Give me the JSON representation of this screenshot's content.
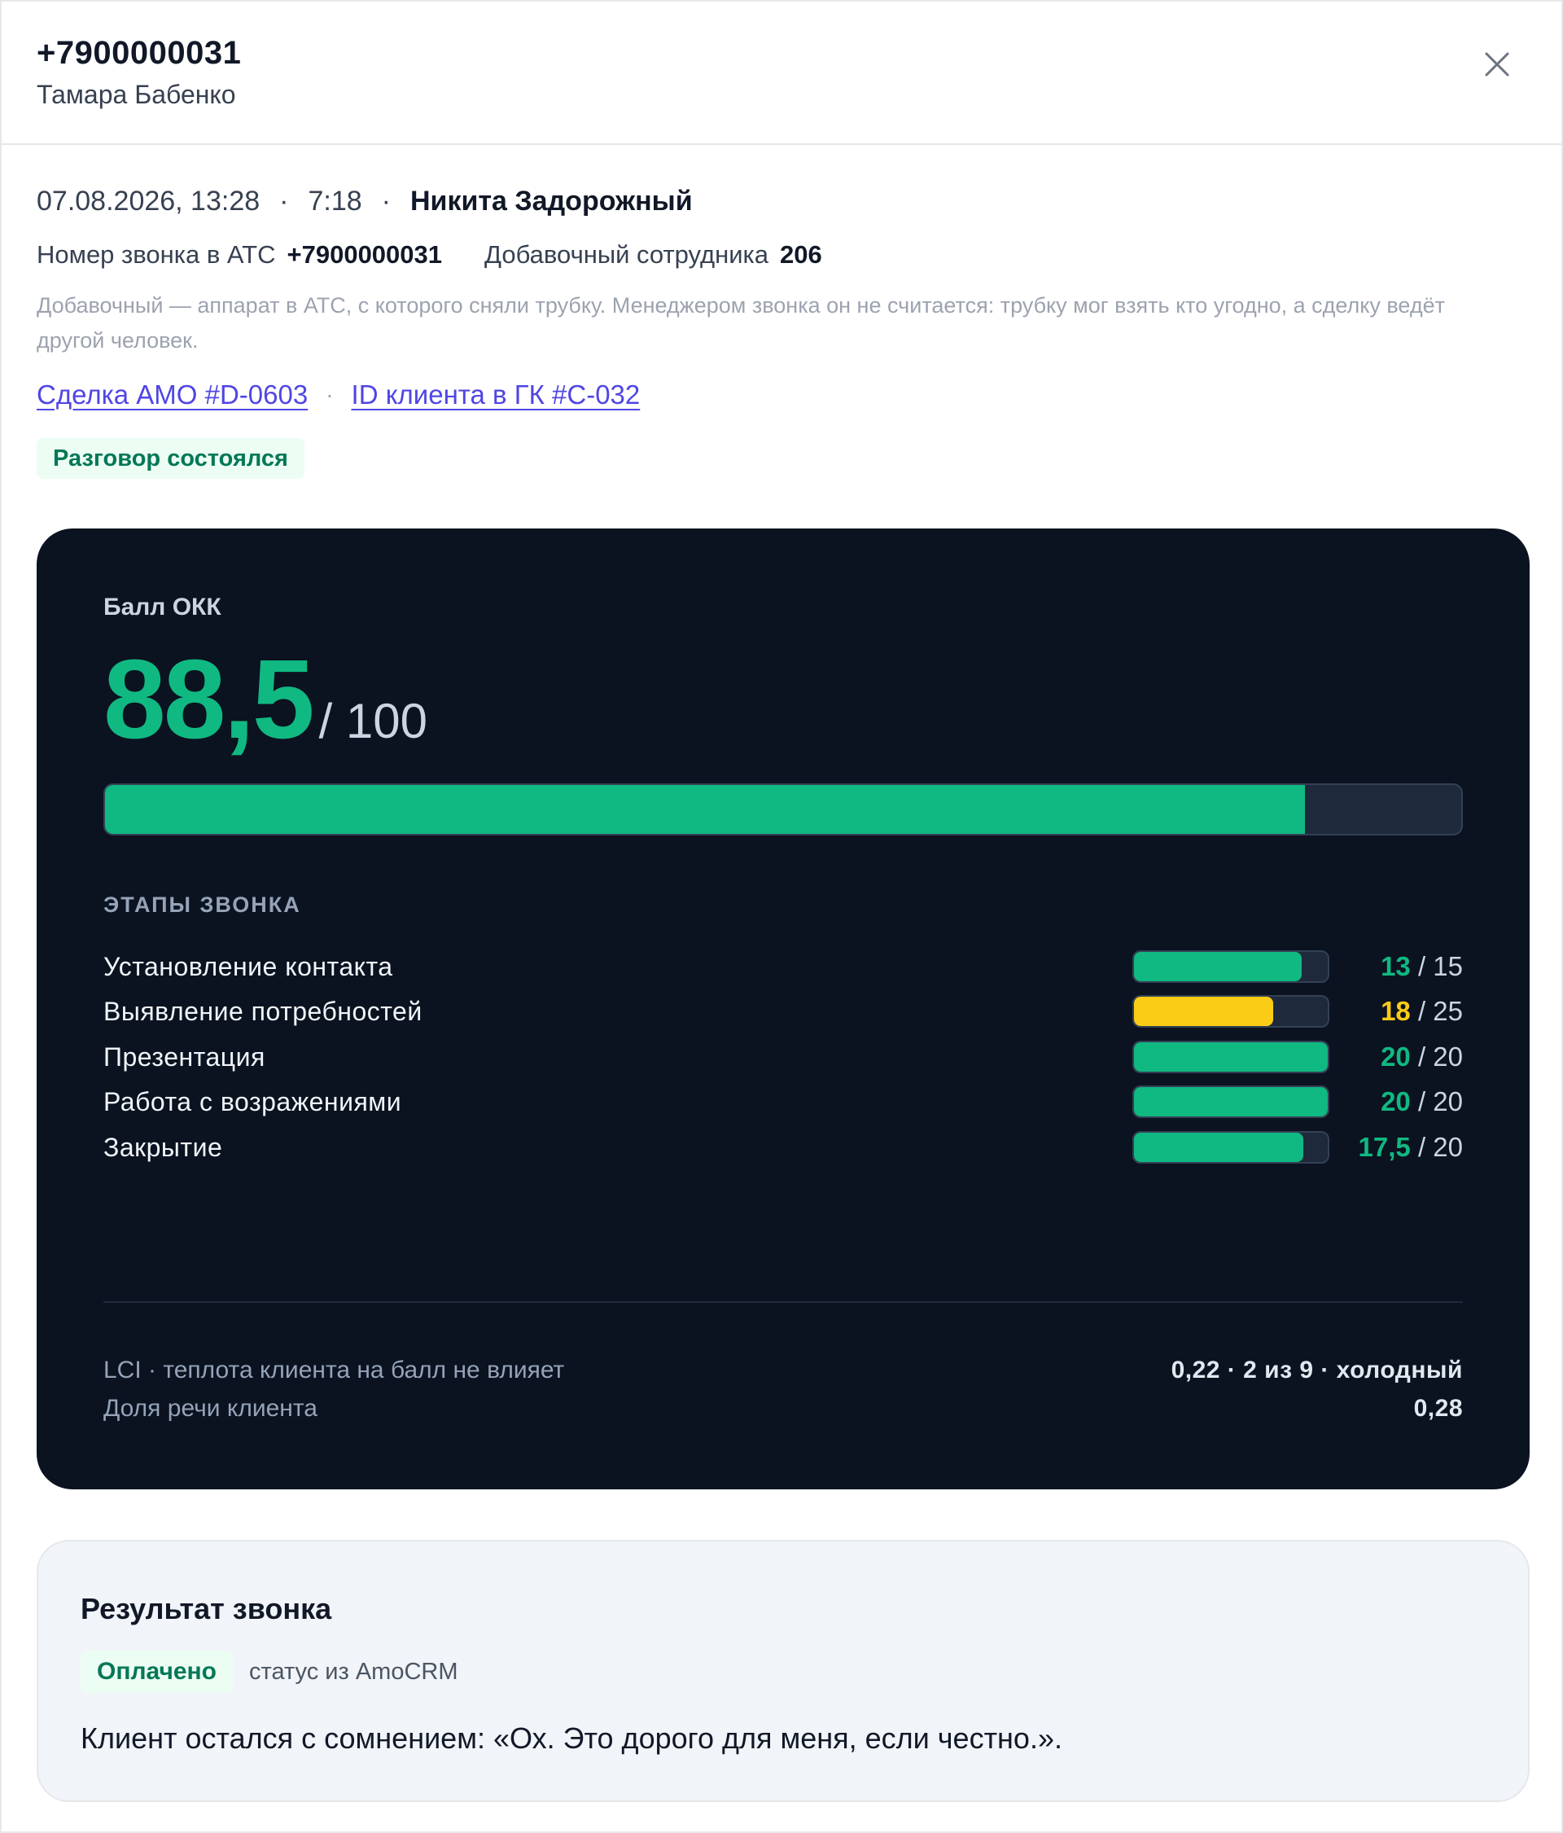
{
  "header": {
    "phone": "+7900000031",
    "client_name": "Тамара Бабенко",
    "close_icon": "close-icon"
  },
  "call": {
    "datetime": "07.08.2026, 13:28",
    "separator": "·",
    "duration": "7:18",
    "manager": "Никита Задорожный",
    "pbx_number_label": "Номер звонка в АТС",
    "pbx_number": "+7900000031",
    "extension_label": "Добавочный сотрудника",
    "extension": "206",
    "hint": "Добавочный — аппарат в АТС, с которого сняли трубку. Менеджером звонка он не считается: трубку мог взять кто угодно, а сделку ведёт другой человек.",
    "deal_link": "Сделка АМО #D-0603",
    "client_link": "ID клиента в ГК #C-032",
    "status_badge": "Разговор состоялся"
  },
  "score": {
    "label": "Балл ОКК",
    "value": "88,5",
    "max": "/ 100",
    "fraction": 0.885,
    "stages_title": "ЭТАПЫ ЗВОНКА",
    "stages": [
      {
        "label": "Установление контакта",
        "got": "13",
        "max": " / 15",
        "fraction": 0.867,
        "color": "#10b981"
      },
      {
        "label": "Выявление потребностей",
        "got": "18",
        "max": " / 25",
        "fraction": 0.72,
        "color": "#facc15"
      },
      {
        "label": "Презентация",
        "got": "20",
        "max": " / 20",
        "fraction": 1.0,
        "color": "#10b981"
      },
      {
        "label": "Работа с возражениями",
        "got": "20",
        "max": " / 20",
        "fraction": 1.0,
        "color": "#10b981"
      },
      {
        "label": "Закрытие",
        "got": "17,5",
        "max": " / 20",
        "fraction": 0.875,
        "color": "#10b981"
      }
    ],
    "lci_label": "LCI · теплота клиента на балл не влияет",
    "lci_value": "0,22 · 2 из 9 · холодный",
    "talk_share_label": "Доля речи клиента",
    "talk_share_value": "0,28"
  },
  "result": {
    "title": "Результат звонка",
    "badge": "Оплачено",
    "source": "статус из AmoCRM",
    "text": "Клиент остался с сомнением: «Ох. Это дорого для меня, если честно.»."
  },
  "colors": {
    "accent_green": "#10b981",
    "accent_yellow": "#facc15",
    "link": "#4f46e5",
    "card_dark": "#0b1220"
  }
}
